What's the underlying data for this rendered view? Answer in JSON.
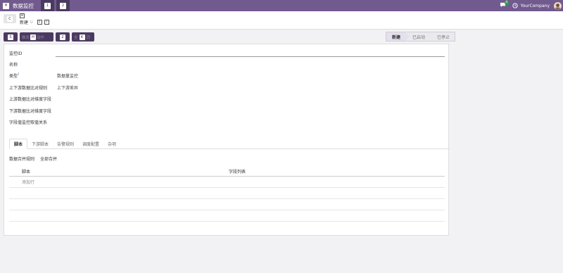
{
  "topbar": {
    "app_key": "H",
    "app_title": "数据监控",
    "menu_keys": [
      "1",
      "2"
    ],
    "chat_badge": "4",
    "company": "YourCompany",
    "colors": {
      "bar": "#715a8e",
      "menu": "#4b3a60"
    }
  },
  "breadcrumb": {
    "back_key": "C",
    "parent_key": "B",
    "current": "新建",
    "gear_key": "U",
    "pager_keys": [
      "5",
      "7"
    ]
  },
  "actions": {
    "save_key": "S",
    "btn2_pre": "触发",
    "btn2_key": "H",
    "btn2_post": "动作",
    "btn3_key": "2",
    "btn4_pre": "全",
    "btn4_key": "K",
    "btn4_post": "消"
  },
  "status": {
    "steps": [
      "新建",
      "已启动",
      "已停止"
    ],
    "active": "新建"
  },
  "form": {
    "fields": [
      {
        "label": "监控ID",
        "value": ""
      },
      {
        "label": "名称",
        "value": ""
      },
      {
        "label": "类型",
        "help": "?",
        "value": "数据量监控"
      },
      {
        "label": "上下游数据比对规则",
        "value": "上下游差异"
      },
      {
        "label": "上游数据比对维度字段",
        "value": ""
      },
      {
        "label": "下游数据比对维度字段",
        "value": ""
      },
      {
        "label": "字段值监控取值关系",
        "value": ""
      }
    ]
  },
  "tabs": [
    "脚本",
    "下游脚本",
    "告警规则",
    "调度配置",
    "杂项"
  ],
  "active_tab": "脚本",
  "merge_rule": {
    "label": "数据合并规则",
    "value": "全部合并"
  },
  "table": {
    "headers": [
      "脚本",
      "字段列表"
    ],
    "add_line": "添加行"
  }
}
